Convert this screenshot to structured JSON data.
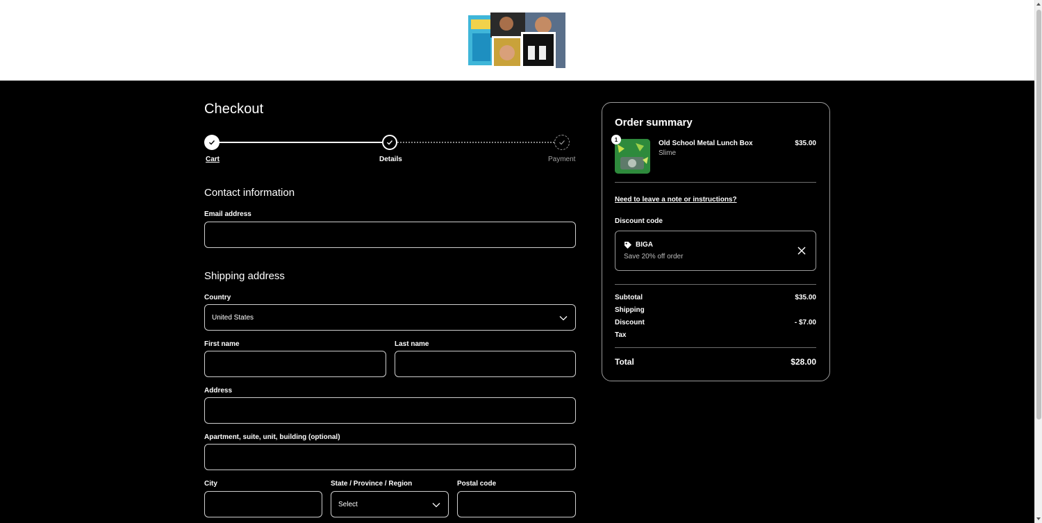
{
  "header": {
    "logo_alt": "Store logo collage"
  },
  "checkout": {
    "title": "Checkout",
    "steps": [
      {
        "label": "Cart",
        "state": "complete"
      },
      {
        "label": "Details",
        "state": "current"
      },
      {
        "label": "Payment",
        "state": "upcoming"
      }
    ],
    "contact": {
      "title": "Contact information",
      "email_label": "Email address",
      "email_value": ""
    },
    "shipping": {
      "title": "Shipping address",
      "country_label": "Country",
      "country_value": "United States",
      "first_name_label": "First name",
      "last_name_label": "Last name",
      "address_label": "Address",
      "apartment_label": "Apartment, suite, unit, building (optional)",
      "city_label": "City",
      "state_label": "State / Province / Region",
      "state_value": "Select",
      "postal_label": "Postal code"
    }
  },
  "summary": {
    "title": "Order summary",
    "item": {
      "quantity": "1",
      "name": "Old School Metal Lunch Box",
      "variant": "Slime",
      "price": "$35.00"
    },
    "note_link": "Need to leave a note or instructions?",
    "discount_label": "Discount code",
    "discount": {
      "code": "BIGA",
      "description": "Save 20% off order"
    },
    "rows": [
      {
        "label": "Subtotal",
        "value": "$35.00"
      },
      {
        "label": "Shipping",
        "value": ""
      },
      {
        "label": "Discount",
        "value": "- $7.00"
      },
      {
        "label": "Tax",
        "value": ""
      }
    ],
    "total_label": "Total",
    "total_value": "$28.00"
  },
  "colors": {
    "background": "#000000",
    "header": "#ffffff",
    "border": "#cfcfcf",
    "muted": "#bdbdbd"
  }
}
